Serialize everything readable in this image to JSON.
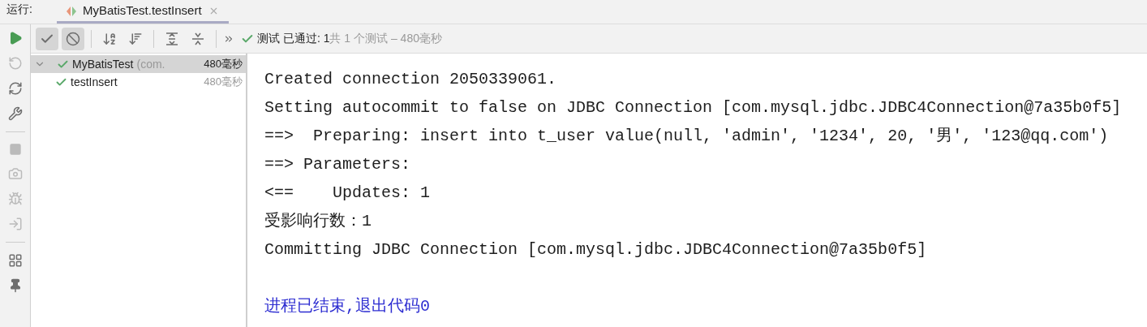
{
  "tab_bar": {
    "label": "运行:",
    "tab": {
      "title": "MyBatisTest.testInsert",
      "selected": true
    }
  },
  "toolbar": {
    "toggles": [
      {
        "kind": "passed",
        "on": true
      },
      {
        "kind": "ignored",
        "on": true
      }
    ],
    "status": {
      "prefix": "测试",
      "passed": "已通过:",
      "count": "1",
      "summary": "共 1 个测试 – 480毫秒"
    }
  },
  "tree": [
    {
      "name": "MyBatisTest",
      "detail": "(com.",
      "duration": "480毫秒",
      "selected": true,
      "expanded": true,
      "children": [
        {
          "name": "testInsert",
          "duration": "480毫秒",
          "selected": false
        }
      ]
    }
  ],
  "console": [
    {
      "kind": "output",
      "text": "Created connection 2050339061."
    },
    {
      "kind": "output",
      "text": "Setting autocommit to false on JDBC Connection [com.mysql.jdbc.JDBC4Connection@7a35b0f5]"
    },
    {
      "kind": "output",
      "text": "==>  Preparing: insert into t_user value(null, 'admin', '1234', 20, '男', '123@qq.com')"
    },
    {
      "kind": "output",
      "text": "==> Parameters: "
    },
    {
      "kind": "output",
      "text": "<==    Updates: 1"
    },
    {
      "kind": "output",
      "text": "受影响行数：1"
    },
    {
      "kind": "output",
      "text": "Committing JDBC Connection [com.mysql.jdbc.JDBC4Connection@7a35b0f5]"
    },
    {
      "kind": "exit",
      "text": "进程已结束,退出代码0"
    }
  ]
}
